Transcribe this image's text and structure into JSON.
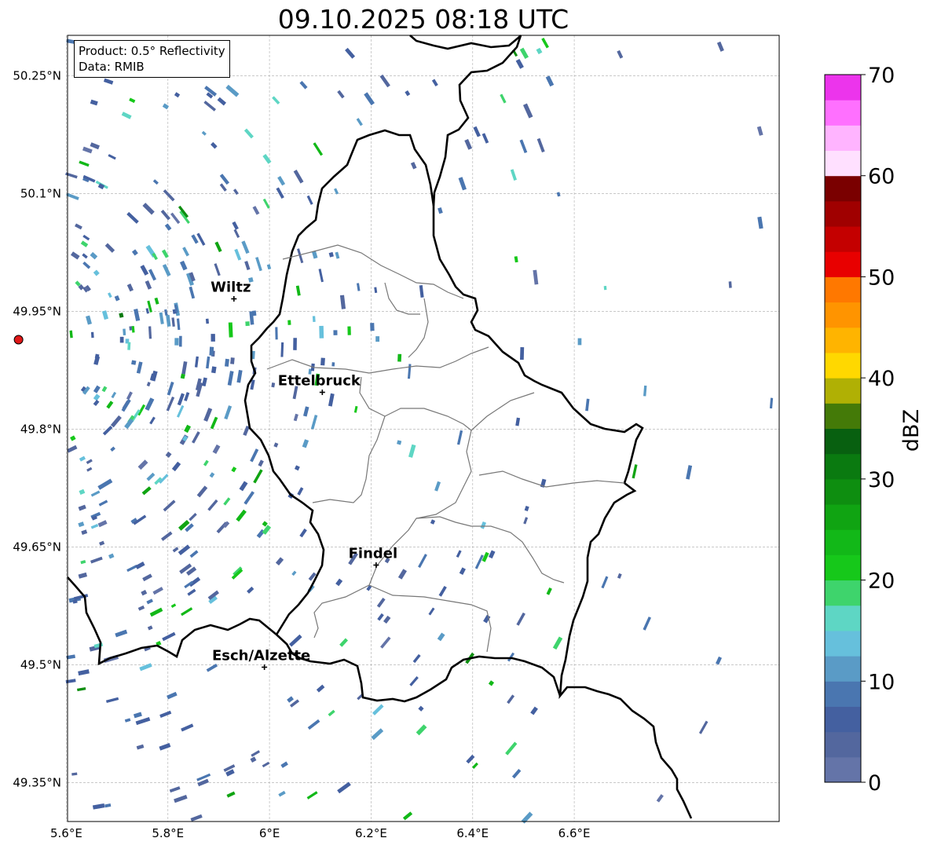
{
  "title": "09.10.2025 08:18 UTC",
  "info": {
    "product": "Product: 0.5° Reflectivity",
    "data_source": "Data: RMIB"
  },
  "map": {
    "lon_range": [
      5.4,
      6.8
    ],
    "lat_range": [
      49.3,
      50.3
    ],
    "x_ticks": [
      {
        "value": 5.6,
        "label": "5.6°E"
      },
      {
        "value": 5.8,
        "label": "5.8°E"
      },
      {
        "value": 6.0,
        "label": "6°E"
      },
      {
        "value": 6.2,
        "label": "6.2°E"
      },
      {
        "value": 6.4,
        "label": "6.4°E"
      },
      {
        "value": 6.6,
        "label": "6.6°E"
      }
    ],
    "y_ticks": [
      {
        "value": 50.25,
        "label": "50.25°N"
      },
      {
        "value": 50.1,
        "label": "50.1°N"
      },
      {
        "value": 49.95,
        "label": "49.95°N"
      },
      {
        "value": 49.8,
        "label": "49.8°N"
      },
      {
        "value": 49.65,
        "label": "49.65°N"
      },
      {
        "value": 49.5,
        "label": "49.5°N"
      },
      {
        "value": 49.35,
        "label": "49.35°N"
      }
    ],
    "grid": true,
    "radar_site": {
      "lon": 5.506,
      "lat": 49.914
    },
    "cities": [
      {
        "name": "Wiltz",
        "lon": 5.93,
        "lat": 49.966
      },
      {
        "name": "Ettelbruck",
        "lon": 6.104,
        "lat": 49.847
      },
      {
        "name": "Findel",
        "lon": 6.21,
        "lat": 49.627
      },
      {
        "name": "Esch/Alzette",
        "lon": 5.99,
        "lat": 49.497
      }
    ]
  },
  "colorbar": {
    "label": "dBZ",
    "min": 0,
    "max": 70,
    "tick_values": [
      0,
      10,
      20,
      30,
      40,
      50,
      60,
      70
    ],
    "colors": [
      "#6474a8",
      "#53679e",
      "#4460a0",
      "#4a76b0",
      "#5a9bc6",
      "#66c0dc",
      "#5ed6c4",
      "#3ed46c",
      "#16c81a",
      "#12b818",
      "#10a412",
      "#0e8e10",
      "#0a7a10",
      "#086010",
      "#447a08",
      "#b0b004",
      "#ffd800",
      "#ffb400",
      "#ff9400",
      "#ff7800",
      "#e80000",
      "#c40000",
      "#a00000",
      "#7a0000",
      "#ffe0ff",
      "#ffb4ff",
      "#ff70ff",
      "#ec34ec"
    ]
  }
}
